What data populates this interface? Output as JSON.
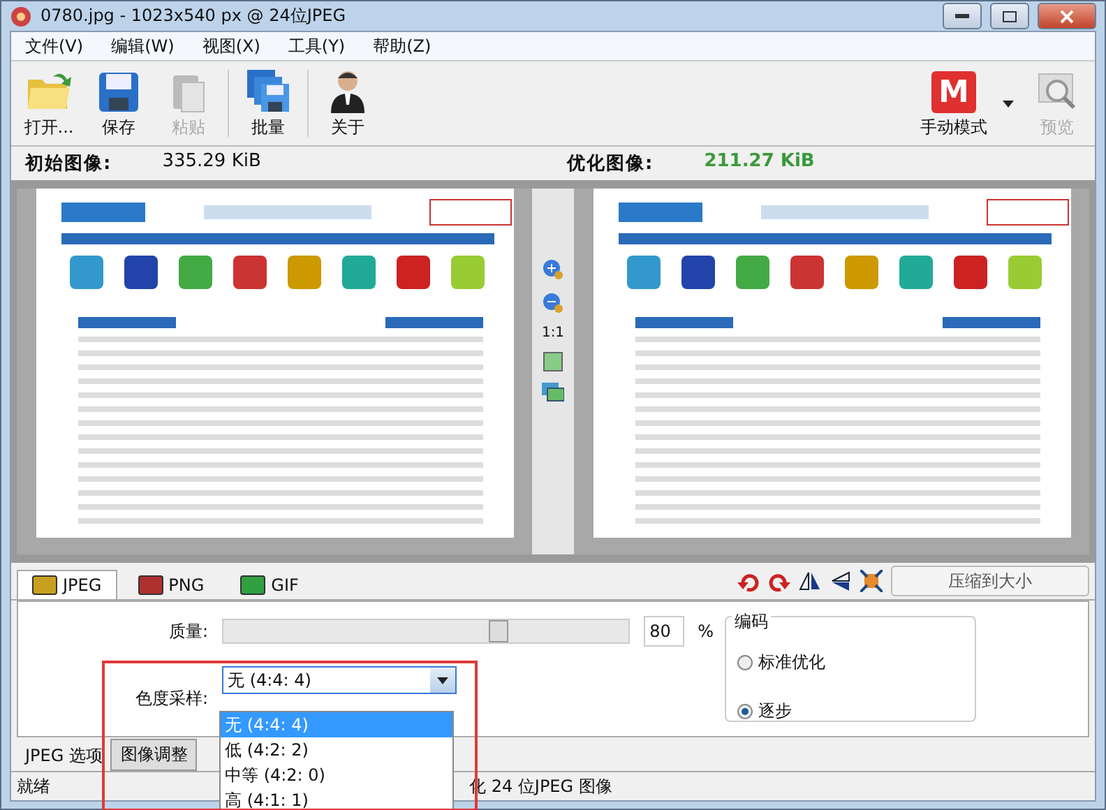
{
  "window": {
    "title": "0780.jpg - 1023x540 px @ 24位JPEG"
  },
  "menu": [
    "文件(V)",
    "编辑(W)",
    "视图(X)",
    "工具(Y)",
    "帮助(Z)"
  ],
  "toolbar": [
    {
      "kind": "open",
      "label": "打开...",
      "disabled": false
    },
    {
      "kind": "save",
      "label": "保存",
      "disabled": false
    },
    {
      "kind": "paste",
      "label": "粘贴",
      "disabled": true
    },
    {
      "kind": "batch",
      "label": "批量",
      "disabled": false
    },
    {
      "kind": "about",
      "label": "关于",
      "disabled": false
    }
  ],
  "mode_button": {
    "letter": "M",
    "label": "手动模式"
  },
  "preview_button": {
    "label": "预览",
    "disabled": true
  },
  "original": {
    "label": "初始图像:",
    "size": "335.29 KiB"
  },
  "optimized": {
    "label": "优化图像:",
    "size": "211.27 KiB"
  },
  "zoom_ratio": "1:1",
  "format_tabs": [
    {
      "label": "JPEG",
      "selected": true,
      "color": "#c8a020"
    },
    {
      "label": "PNG",
      "selected": false,
      "color": "#b03030"
    },
    {
      "label": "GIF",
      "selected": false,
      "color": "#30a040"
    }
  ],
  "compress_button": {
    "label": "压缩到大小"
  },
  "quality": {
    "label": "质量:",
    "level": 0.68,
    "value": "80",
    "unit": "%"
  },
  "chroma": {
    "label": "色度采样:",
    "value": "无 (4:4: 4)",
    "expanded": true,
    "options": [
      {
        "label": "无 (4:4: 4)",
        "selected": true
      },
      {
        "label": "低 (4:2: 2)",
        "selected": false
      },
      {
        "label": "中等 (4:2: 0)",
        "selected": false
      },
      {
        "label": "高 (4:1: 1)",
        "selected": false
      }
    ]
  },
  "encoding": {
    "title": "编码",
    "options": [
      {
        "label": "标准优化",
        "selected": false
      },
      {
        "label": "逐步",
        "selected": true
      }
    ]
  },
  "option_tabs": [
    {
      "label": "JPEG 选项",
      "selected": true
    },
    {
      "label": "图像调整",
      "selected": false
    }
  ],
  "status_bar": [
    "就绪",
    "化 24 位JPEG 图像"
  ]
}
